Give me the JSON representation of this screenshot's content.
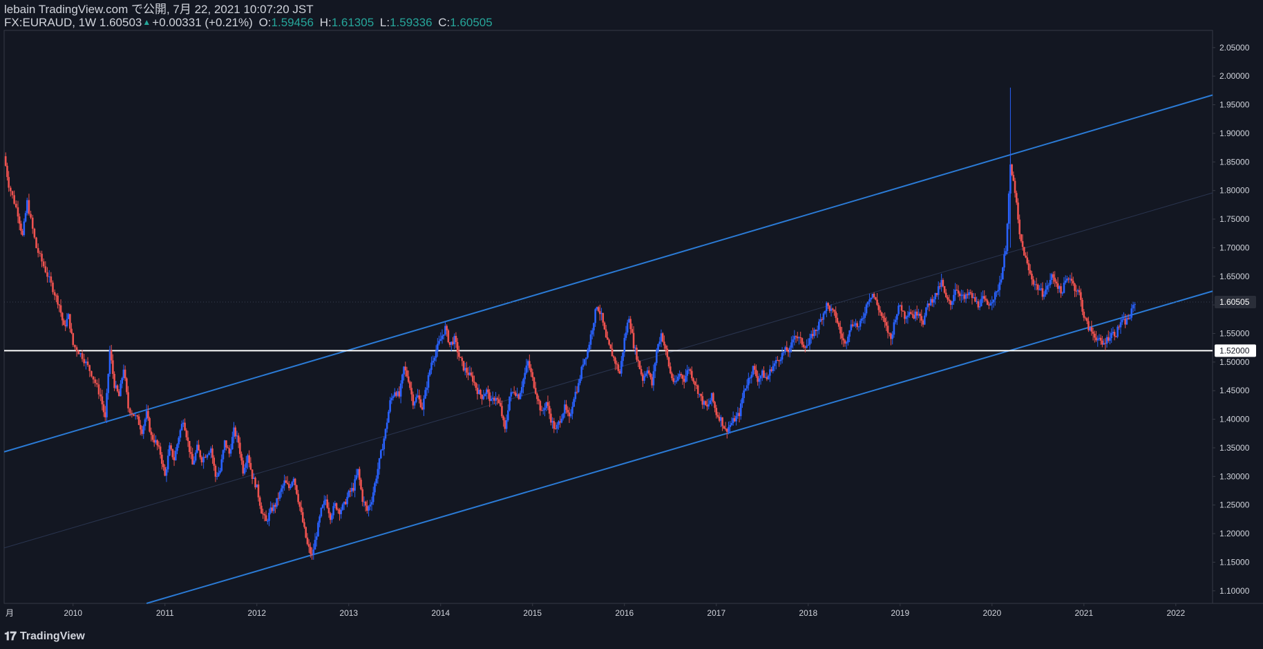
{
  "header": {
    "line1": "lebain TradingView.com で公開, 7月 22, 2021 10:07:20 JST",
    "symbol": "FX:EURAUD, 1W",
    "last": "1.60503",
    "change": "+0.00331 (+0.21%)",
    "o_label": "O:",
    "o_value": "1.59456",
    "h_label": "H:",
    "h_value": "1.61305",
    "l_label": "L:",
    "l_value": "1.59336",
    "c_label": "C:",
    "c_value": "1.60505"
  },
  "footer": {
    "brand": "TradingView",
    "logo_icon": "tradingview-logo-icon"
  },
  "colors": {
    "background": "#131722",
    "up": "#2962ff",
    "down": "#ef5350",
    "channel": "#2b7bd6",
    "support": "#ffffff",
    "grid_text": "#d1d4dc"
  },
  "chart_data": {
    "type": "candlestick",
    "symbol": "FX:EURAUD",
    "interval": "1W",
    "x_axis": {
      "first_label": "月",
      "ticks": [
        "2010",
        "2011",
        "2012",
        "2013",
        "2014",
        "2015",
        "2016",
        "2017",
        "2018",
        "2019",
        "2020",
        "2021",
        "2022"
      ],
      "range": [
        2009.25,
        2022.4
      ]
    },
    "y_axis": {
      "ticks": [
        "2.05000",
        "2.00000",
        "1.95000",
        "1.90000",
        "1.85000",
        "1.80000",
        "1.75000",
        "1.70000",
        "1.65000",
        "1.60000",
        "1.55000",
        "1.50000",
        "1.45000",
        "1.40000",
        "1.35000",
        "1.30000",
        "1.25000",
        "1.20000",
        "1.15000",
        "1.10000"
      ],
      "range": [
        1.078,
        2.08
      ],
      "position": "right"
    },
    "price_labels": [
      {
        "value": "1.60505",
        "style": "last-price"
      },
      {
        "value": "1.52000",
        "style": "horizontal-line"
      }
    ],
    "close_path": [
      [
        2009.25,
        1.86
      ],
      [
        2009.3,
        1.81
      ],
      [
        2009.4,
        1.76
      ],
      [
        2009.45,
        1.72
      ],
      [
        2009.5,
        1.78
      ],
      [
        2009.6,
        1.7
      ],
      [
        2009.7,
        1.66
      ],
      [
        2009.8,
        1.62
      ],
      [
        2009.85,
        1.6
      ],
      [
        2009.9,
        1.56
      ],
      [
        2009.95,
        1.58
      ],
      [
        2010.0,
        1.53
      ],
      [
        2010.1,
        1.51
      ],
      [
        2010.2,
        1.48
      ],
      [
        2010.3,
        1.44
      ],
      [
        2010.35,
        1.4
      ],
      [
        2010.4,
        1.52
      ],
      [
        2010.45,
        1.46
      ],
      [
        2010.5,
        1.44
      ],
      [
        2010.55,
        1.49
      ],
      [
        2010.6,
        1.42
      ],
      [
        2010.7,
        1.4
      ],
      [
        2010.75,
        1.38
      ],
      [
        2010.8,
        1.41
      ],
      [
        2010.85,
        1.37
      ],
      [
        2010.9,
        1.36
      ],
      [
        2010.95,
        1.34
      ],
      [
        2011.0,
        1.3
      ],
      [
        2011.05,
        1.35
      ],
      [
        2011.1,
        1.33
      ],
      [
        2011.15,
        1.37
      ],
      [
        2011.2,
        1.4
      ],
      [
        2011.25,
        1.36
      ],
      [
        2011.3,
        1.32
      ],
      [
        2011.35,
        1.35
      ],
      [
        2011.4,
        1.33
      ],
      [
        2011.5,
        1.35
      ],
      [
        2011.55,
        1.3
      ],
      [
        2011.6,
        1.31
      ],
      [
        2011.65,
        1.36
      ],
      [
        2011.7,
        1.34
      ],
      [
        2011.75,
        1.38
      ],
      [
        2011.8,
        1.36
      ],
      [
        2011.85,
        1.31
      ],
      [
        2011.9,
        1.34
      ],
      [
        2011.95,
        1.3
      ],
      [
        2012.0,
        1.28
      ],
      [
        2012.05,
        1.24
      ],
      [
        2012.1,
        1.22
      ],
      [
        2012.15,
        1.24
      ],
      [
        2012.2,
        1.25
      ],
      [
        2012.25,
        1.27
      ],
      [
        2012.3,
        1.29
      ],
      [
        2012.35,
        1.28
      ],
      [
        2012.4,
        1.3
      ],
      [
        2012.45,
        1.26
      ],
      [
        2012.5,
        1.22
      ],
      [
        2012.55,
        1.18
      ],
      [
        2012.6,
        1.16
      ],
      [
        2012.65,
        1.2
      ],
      [
        2012.7,
        1.24
      ],
      [
        2012.75,
        1.26
      ],
      [
        2012.8,
        1.23
      ],
      [
        2012.85,
        1.25
      ],
      [
        2012.9,
        1.24
      ],
      [
        2012.95,
        1.25
      ],
      [
        2013.0,
        1.27
      ],
      [
        2013.05,
        1.28
      ],
      [
        2013.1,
        1.31
      ],
      [
        2013.15,
        1.26
      ],
      [
        2013.2,
        1.24
      ],
      [
        2013.25,
        1.26
      ],
      [
        2013.3,
        1.3
      ],
      [
        2013.35,
        1.34
      ],
      [
        2013.4,
        1.38
      ],
      [
        2013.45,
        1.43
      ],
      [
        2013.5,
        1.45
      ],
      [
        2013.55,
        1.44
      ],
      [
        2013.6,
        1.49
      ],
      [
        2013.65,
        1.47
      ],
      [
        2013.7,
        1.43
      ],
      [
        2013.75,
        1.44
      ],
      [
        2013.8,
        1.42
      ],
      [
        2013.85,
        1.46
      ],
      [
        2013.9,
        1.5
      ],
      [
        2013.95,
        1.52
      ],
      [
        2014.0,
        1.54
      ],
      [
        2014.05,
        1.56
      ],
      [
        2014.1,
        1.53
      ],
      [
        2014.15,
        1.54
      ],
      [
        2014.2,
        1.51
      ],
      [
        2014.25,
        1.49
      ],
      [
        2014.3,
        1.48
      ],
      [
        2014.35,
        1.47
      ],
      [
        2014.4,
        1.45
      ],
      [
        2014.45,
        1.44
      ],
      [
        2014.5,
        1.45
      ],
      [
        2014.55,
        1.43
      ],
      [
        2014.6,
        1.44
      ],
      [
        2014.65,
        1.42
      ],
      [
        2014.7,
        1.38
      ],
      [
        2014.75,
        1.44
      ],
      [
        2014.8,
        1.45
      ],
      [
        2014.85,
        1.44
      ],
      [
        2014.9,
        1.47
      ],
      [
        2014.95,
        1.5
      ],
      [
        2015.0,
        1.47
      ],
      [
        2015.05,
        1.44
      ],
      [
        2015.1,
        1.41
      ],
      [
        2015.15,
        1.43
      ],
      [
        2015.2,
        1.4
      ],
      [
        2015.25,
        1.38
      ],
      [
        2015.3,
        1.4
      ],
      [
        2015.35,
        1.42
      ],
      [
        2015.4,
        1.4
      ],
      [
        2015.45,
        1.44
      ],
      [
        2015.5,
        1.46
      ],
      [
        2015.55,
        1.5
      ],
      [
        2015.6,
        1.52
      ],
      [
        2015.65,
        1.56
      ],
      [
        2015.7,
        1.6
      ],
      [
        2015.75,
        1.58
      ],
      [
        2015.8,
        1.54
      ],
      [
        2015.85,
        1.52
      ],
      [
        2015.9,
        1.5
      ],
      [
        2015.95,
        1.48
      ],
      [
        2016.0,
        1.54
      ],
      [
        2016.05,
        1.58
      ],
      [
        2016.1,
        1.53
      ],
      [
        2016.15,
        1.5
      ],
      [
        2016.2,
        1.47
      ],
      [
        2016.25,
        1.49
      ],
      [
        2016.3,
        1.46
      ],
      [
        2016.35,
        1.52
      ],
      [
        2016.4,
        1.55
      ],
      [
        2016.45,
        1.52
      ],
      [
        2016.5,
        1.48
      ],
      [
        2016.55,
        1.46
      ],
      [
        2016.6,
        1.48
      ],
      [
        2016.65,
        1.47
      ],
      [
        2016.7,
        1.49
      ],
      [
        2016.75,
        1.47
      ],
      [
        2016.8,
        1.45
      ],
      [
        2016.85,
        1.43
      ],
      [
        2016.9,
        1.42
      ],
      [
        2016.95,
        1.44
      ],
      [
        2017.0,
        1.41
      ],
      [
        2017.05,
        1.4
      ],
      [
        2017.1,
        1.38
      ],
      [
        2017.15,
        1.39
      ],
      [
        2017.2,
        1.4
      ],
      [
        2017.25,
        1.41
      ],
      [
        2017.3,
        1.45
      ],
      [
        2017.35,
        1.47
      ],
      [
        2017.4,
        1.49
      ],
      [
        2017.45,
        1.47
      ],
      [
        2017.5,
        1.48
      ],
      [
        2017.55,
        1.47
      ],
      [
        2017.6,
        1.49
      ],
      [
        2017.65,
        1.5
      ],
      [
        2017.7,
        1.51
      ],
      [
        2017.75,
        1.52
      ],
      [
        2017.8,
        1.52
      ],
      [
        2017.85,
        1.55
      ],
      [
        2017.9,
        1.54
      ],
      [
        2017.95,
        1.53
      ],
      [
        2018.0,
        1.53
      ],
      [
        2018.05,
        1.55
      ],
      [
        2018.1,
        1.56
      ],
      [
        2018.15,
        1.58
      ],
      [
        2018.2,
        1.6
      ],
      [
        2018.25,
        1.59
      ],
      [
        2018.3,
        1.58
      ],
      [
        2018.35,
        1.55
      ],
      [
        2018.4,
        1.53
      ],
      [
        2018.45,
        1.56
      ],
      [
        2018.5,
        1.57
      ],
      [
        2018.55,
        1.56
      ],
      [
        2018.6,
        1.58
      ],
      [
        2018.65,
        1.61
      ],
      [
        2018.7,
        1.62
      ],
      [
        2018.75,
        1.6
      ],
      [
        2018.8,
        1.58
      ],
      [
        2018.85,
        1.56
      ],
      [
        2018.9,
        1.54
      ],
      [
        2018.95,
        1.58
      ],
      [
        2019.0,
        1.6
      ],
      [
        2019.05,
        1.58
      ],
      [
        2019.1,
        1.59
      ],
      [
        2019.15,
        1.58
      ],
      [
        2019.2,
        1.59
      ],
      [
        2019.25,
        1.57
      ],
      [
        2019.3,
        1.6
      ],
      [
        2019.35,
        1.61
      ],
      [
        2019.4,
        1.62
      ],
      [
        2019.45,
        1.64
      ],
      [
        2019.5,
        1.61
      ],
      [
        2019.55,
        1.6
      ],
      [
        2019.6,
        1.63
      ],
      [
        2019.65,
        1.62
      ],
      [
        2019.7,
        1.61
      ],
      [
        2019.75,
        1.62
      ],
      [
        2019.8,
        1.61
      ],
      [
        2019.85,
        1.6
      ],
      [
        2019.9,
        1.61
      ],
      [
        2019.95,
        1.6
      ],
      [
        2020.0,
        1.61
      ],
      [
        2020.05,
        1.62
      ],
      [
        2020.1,
        1.65
      ],
      [
        2020.15,
        1.7
      ],
      [
        2020.2,
        1.84
      ],
      [
        2020.25,
        1.8
      ],
      [
        2020.3,
        1.72
      ],
      [
        2020.35,
        1.69
      ],
      [
        2020.4,
        1.66
      ],
      [
        2020.45,
        1.64
      ],
      [
        2020.5,
        1.63
      ],
      [
        2020.55,
        1.62
      ],
      [
        2020.6,
        1.63
      ],
      [
        2020.65,
        1.65
      ],
      [
        2020.7,
        1.64
      ],
      [
        2020.75,
        1.62
      ],
      [
        2020.8,
        1.64
      ],
      [
        2020.85,
        1.65
      ],
      [
        2020.9,
        1.63
      ],
      [
        2020.95,
        1.62
      ],
      [
        2021.0,
        1.58
      ],
      [
        2021.05,
        1.56
      ],
      [
        2021.1,
        1.55
      ],
      [
        2021.15,
        1.54
      ],
      [
        2021.2,
        1.53
      ],
      [
        2021.25,
        1.54
      ],
      [
        2021.3,
        1.55
      ],
      [
        2021.35,
        1.55
      ],
      [
        2021.4,
        1.57
      ],
      [
        2021.45,
        1.57
      ],
      [
        2021.5,
        1.58
      ],
      [
        2021.555,
        1.605
      ]
    ],
    "annotations": [
      {
        "type": "channel-line",
        "name": "upper-channel",
        "from": [
          2009.25,
          1.343
        ],
        "to": [
          2022.4,
          1.967
        ]
      },
      {
        "type": "channel-line",
        "name": "lower-channel",
        "from": [
          2010.8,
          1.078
        ],
        "to": [
          2022.4,
          1.624
        ]
      },
      {
        "type": "median-line",
        "name": "channel-midline",
        "from": [
          2009.25,
          1.175
        ],
        "to": [
          2022.4,
          1.796
        ]
      },
      {
        "type": "horizontal-line",
        "name": "support-line",
        "value": 1.52
      },
      {
        "type": "horizontal-dotted",
        "name": "last-price-line",
        "value": 1.605
      }
    ],
    "grid": false,
    "legend": "none"
  }
}
